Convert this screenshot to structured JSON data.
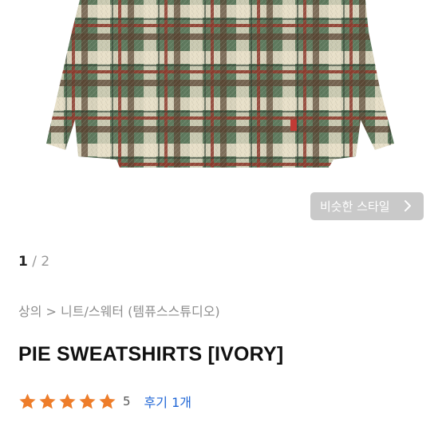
{
  "product": {
    "image_alt": "PIE SWEATSHIRTS [IVORY]",
    "similar_style_label": "비슷한 스타일",
    "pager": {
      "current": "1",
      "separator": "/",
      "total": "2"
    },
    "breadcrumb": {
      "category": "상의",
      "separator": ">",
      "subcategory": "니트/스웨터",
      "brand": "(템퓨스스튜디오)"
    },
    "title": "PIE SWEATSHIRTS [IVORY]",
    "rating": {
      "stars": 5,
      "max": 5,
      "score": "5"
    },
    "reviews_label": "후기 1개"
  },
  "colors": {
    "star": "#ee7d2a",
    "link": "#1f66d6",
    "button_bg": "#c9c9c9",
    "plaid_green": "#5f7a5e",
    "plaid_cream": "#ece2cc",
    "plaid_red": "#8e3b2e",
    "plaid_brown": "#5a4432"
  },
  "icons": [
    "chevron-right-icon",
    "star-icon"
  ]
}
